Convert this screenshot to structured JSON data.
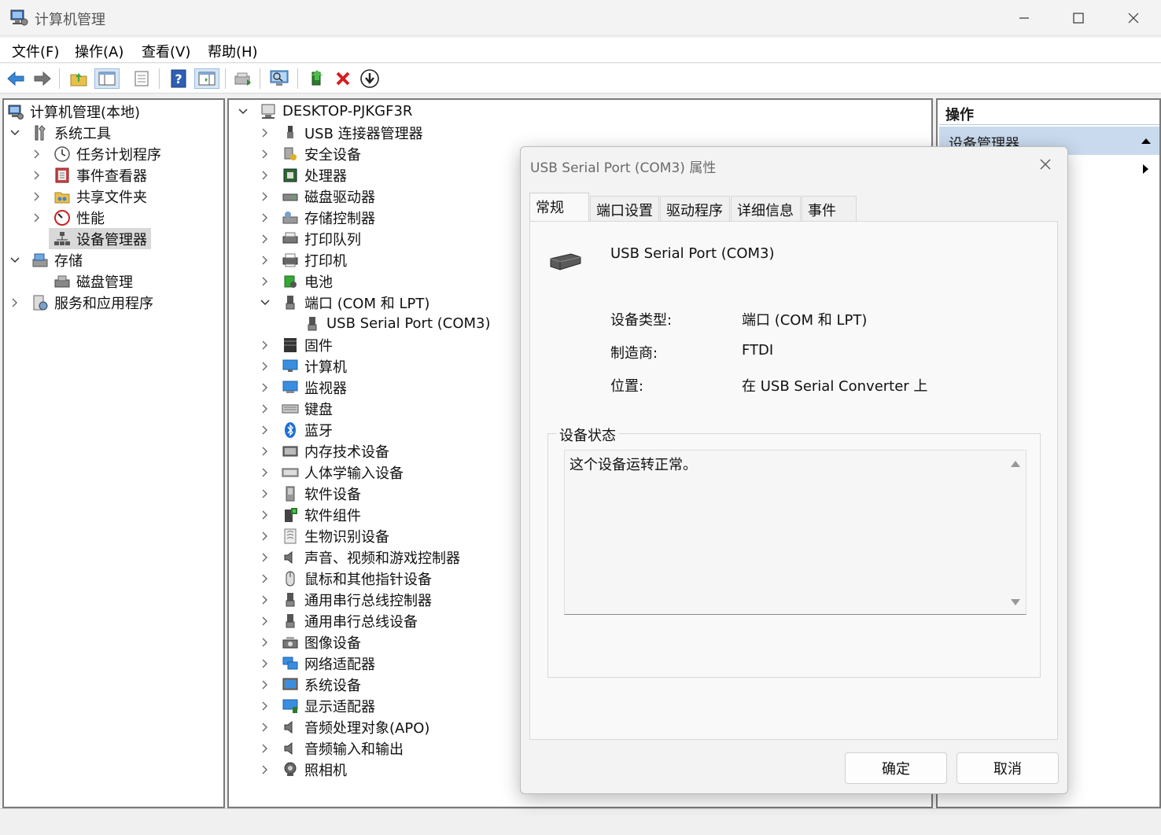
{
  "window": {
    "title": "计算机管理",
    "minimize": "—",
    "maximize": "☐",
    "close": "✕"
  },
  "menu": {
    "items": [
      "文件(F)",
      "操作(A)",
      "查看(V)",
      "帮助(H)"
    ]
  },
  "toolbar": {
    "buttons": [
      "back-icon",
      "forward-icon",
      "up-folder-icon",
      "show-hide-tree-icon",
      "properties-list-icon",
      "help-icon",
      "action-pane-icon",
      "update-driver-icon",
      "scan-hardware-icon",
      "enable-device-icon",
      "uninstall-icon",
      "disable-device-icon"
    ]
  },
  "left_tree": {
    "root": "计算机管理(本地)",
    "system_tools": "系统工具",
    "task_scheduler": "任务计划程序",
    "event_viewer": "事件查看器",
    "shared_folders": "共享文件夹",
    "performance": "性能",
    "device_manager": "设备管理器",
    "storage": "存储",
    "disk_management": "磁盘管理",
    "services_apps": "服务和应用程序"
  },
  "device_tree": {
    "root": "DESKTOP-PJKGF3R",
    "categories": [
      "USB 连接器管理器",
      "安全设备",
      "处理器",
      "磁盘驱动器",
      "存储控制器",
      "打印队列",
      "打印机",
      "电池",
      "端口 (COM 和 LPT)",
      "USB Serial Port (COM3)",
      "固件",
      "计算机",
      "监视器",
      "键盘",
      "蓝牙",
      "内存技术设备",
      "人体学输入设备",
      "软件设备",
      "软件组件",
      "生物识别设备",
      "声音、视频和游戏控制器",
      "鼠标和其他指针设备",
      "通用串行总线控制器",
      "通用串行总线设备",
      "图像设备",
      "网络适配器",
      "系统设备",
      "显示适配器",
      "音频处理对象(APO)",
      "音频输入和输出",
      "照相机"
    ]
  },
  "actions": {
    "header": "操作",
    "sub": "设备管理器"
  },
  "dialog": {
    "title": "USB Serial Port (COM3) 属性",
    "tabs": [
      "常规",
      "端口设置",
      "驱动程序",
      "详细信息",
      "事件"
    ],
    "device_name": "USB Serial Port (COM3)",
    "props": {
      "type_label": "设备类型:",
      "type_value": "端口 (COM 和 LPT)",
      "mfr_label": "制造商:",
      "mfr_value": "FTDI",
      "loc_label": "位置:",
      "loc_value": "在 USB Serial Converter 上"
    },
    "status_legend": "设备状态",
    "status_text": "这个设备运转正常。",
    "ok": "确定",
    "cancel": "取消"
  }
}
